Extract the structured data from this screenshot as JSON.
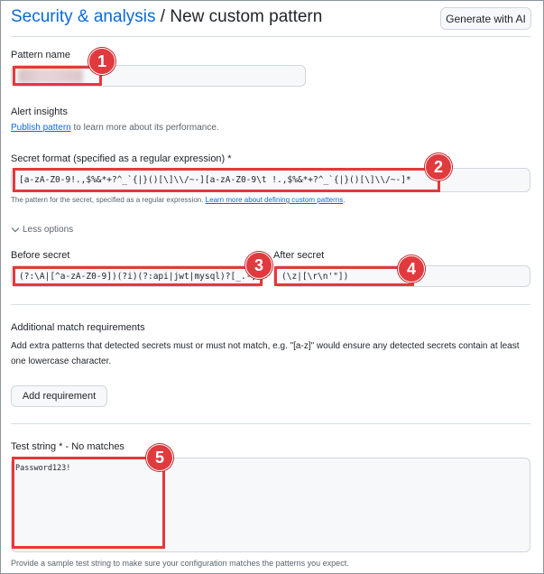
{
  "header": {
    "breadcrumb_parent": "Security & analysis",
    "separator": "/",
    "current_page": "New custom pattern",
    "generate_button": "Generate with AI"
  },
  "pattern_name": {
    "label": "Pattern name",
    "value": ""
  },
  "alert_insights": {
    "title": "Alert insights",
    "link_text": "Publish pattern",
    "text": " to learn more about its performance."
  },
  "secret_format": {
    "label": "Secret format (specified as a regular expression) *",
    "value": "[a-zA-Z0-9!.,$%&*+?^_`{|}()[\\]\\\\/~-][a-zA-Z0-9\\t !.,$%&*+?^_`{|}()[\\]\\\\/~-]*",
    "help_text": "The pattern for the secret, specified as a regular expression. ",
    "help_link": "Learn more about defining custom patterns",
    "help_end": "."
  },
  "options": {
    "toggle_label": "Less options",
    "before_secret_label": "Before secret",
    "before_secret_value": "(?:\\A|[^a-zA-Z0-9])(?i)(?:api|jwt|mysql)?[_.-]",
    "after_secret_label": "After secret",
    "after_secret_value": "(\\z|[\\r\\n'\"])"
  },
  "additional": {
    "title": "Additional match requirements",
    "description": "Add extra patterns that detected secrets must or must not match, e.g. \"[a-z]\" would ensure any detected secrets contain at least one lowercase character.",
    "add_button": "Add requirement"
  },
  "test_string": {
    "label": "Test string * - No matches",
    "value": "Password123!",
    "help_text": "Provide a sample test string to make sure your configuration matches the patterns you expect."
  },
  "callouts": [
    "1",
    "2",
    "3",
    "4",
    "5"
  ],
  "colors": {
    "link": "#0969da",
    "callout": "#e03a3e",
    "input_bg": "#f6f8fa",
    "border": "#d0d7de"
  }
}
